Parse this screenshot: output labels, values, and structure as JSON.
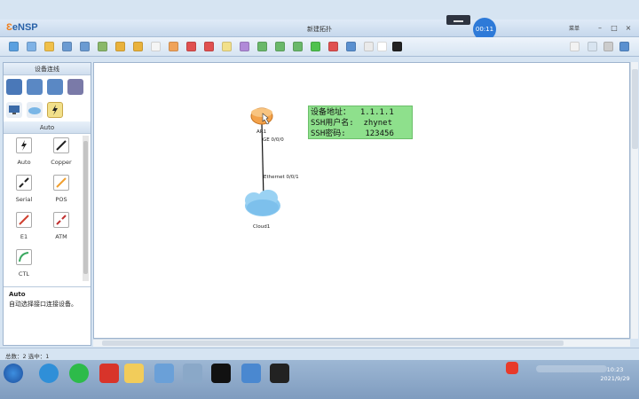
{
  "app": {
    "name": "eNSP",
    "window_title": "新建拓扑",
    "timer": "00:11",
    "menu_label": "菜单"
  },
  "left_panel": {
    "header": "设备连线",
    "category": "Auto",
    "links": [
      {
        "label": "Auto"
      },
      {
        "label": "Copper"
      },
      {
        "label": "Serial"
      },
      {
        "label": "POS"
      },
      {
        "label": "E1"
      },
      {
        "label": "ATM"
      },
      {
        "label": "CTL"
      }
    ],
    "desc_title": "Auto",
    "desc_text": "自动选择接口连接设备。"
  },
  "topology": {
    "router_label": "AR1",
    "router_port": "GE 0/0/0",
    "cloud_label": "Cloud1",
    "cloud_port": "Ethernet 0/0/1",
    "note": "设备地址：  1.1.1.1\nSSH用户名:  zhynet\nSSH密码:    123456"
  },
  "status": {
    "text": "总数：2  选中：1"
  },
  "clock": {
    "time": "10:23",
    "date": "2021/9/29"
  },
  "colors": {
    "note_bg": "#8ee08c",
    "accent": "#2a62a8",
    "timer": "#2e7ad8"
  }
}
